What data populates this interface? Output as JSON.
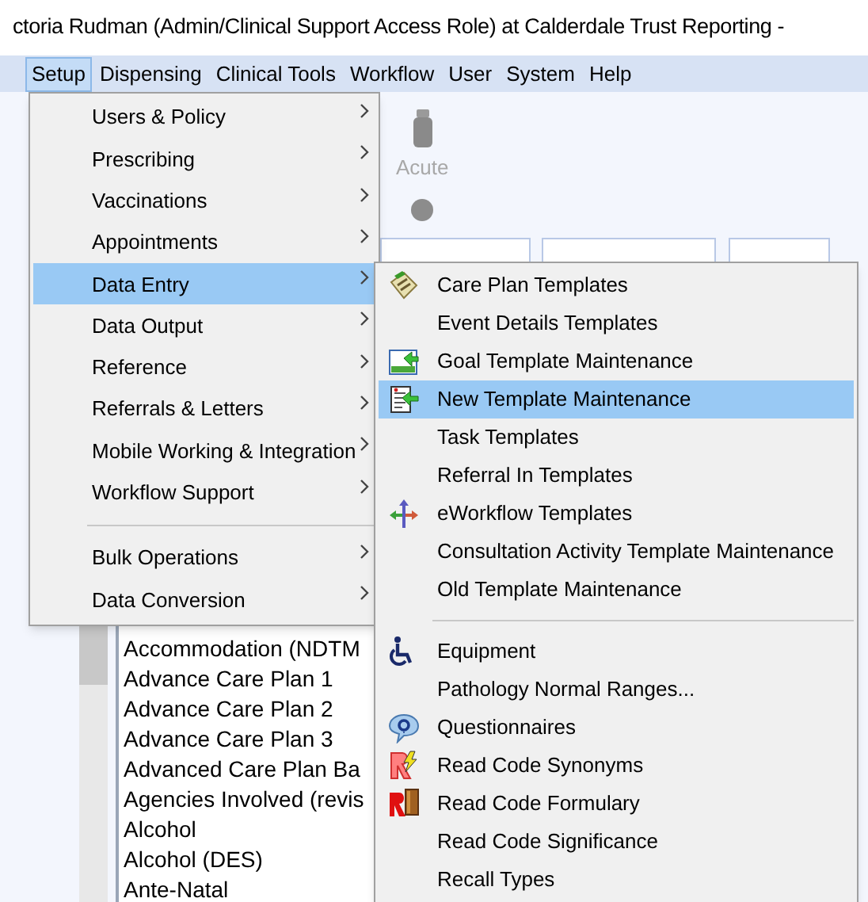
{
  "window": {
    "title": "ctoria Rudman (Admin/Clinical Support Access Role) at Calderdale Trust Reporting -"
  },
  "menu_bar": [
    {
      "label": "Setup",
      "selected": true
    },
    {
      "label": "Dispensing",
      "selected": false
    },
    {
      "label": "Clinical Tools",
      "selected": false
    },
    {
      "label": "Workflow",
      "selected": false
    },
    {
      "label": "User",
      "selected": false
    },
    {
      "label": "System",
      "selected": false
    },
    {
      "label": "Help",
      "selected": false
    }
  ],
  "toolbar": {
    "acute_label": "Acute"
  },
  "list_items": [
    "Accommodation (NDTM",
    "Advance Care Plan 1",
    "Advance Care Plan 2",
    "Advance Care Plan 3",
    "Advanced Care Plan Ba",
    "Agencies Involved (revis",
    "Alcohol",
    "Alcohol (DES)",
    "Ante-Natal"
  ],
  "setup_menu": [
    {
      "kind": "item",
      "label": "Users & Policy",
      "selected": false
    },
    {
      "kind": "item",
      "label": "Prescribing",
      "selected": false
    },
    {
      "kind": "item",
      "label": "Vaccinations",
      "selected": false
    },
    {
      "kind": "item",
      "label": "Appointments",
      "selected": false
    },
    {
      "kind": "item",
      "label": "Data Entry",
      "selected": true
    },
    {
      "kind": "item",
      "label": "Data Output",
      "selected": false
    },
    {
      "kind": "item",
      "label": "Reference",
      "selected": false
    },
    {
      "kind": "item",
      "label": "Referrals & Letters",
      "selected": false
    },
    {
      "kind": "item",
      "label": "Mobile Working & Integration",
      "selected": false
    },
    {
      "kind": "item",
      "label": "Workflow Support",
      "selected": false
    },
    {
      "kind": "separator"
    },
    {
      "kind": "item",
      "label": "Bulk Operations",
      "selected": false
    },
    {
      "kind": "item",
      "label": "Data Conversion",
      "selected": false
    }
  ],
  "data_entry_menu": [
    {
      "kind": "item",
      "label": "Care Plan Templates",
      "selected": false
    },
    {
      "kind": "item",
      "label": "Event Details Templates",
      "selected": false
    },
    {
      "kind": "item",
      "label": "Goal Template Maintenance",
      "selected": false
    },
    {
      "kind": "item",
      "label": "New Template Maintenance",
      "selected": true
    },
    {
      "kind": "item",
      "label": "Task Templates",
      "selected": false
    },
    {
      "kind": "item",
      "label": "Referral In Templates",
      "selected": false
    },
    {
      "kind": "item",
      "label": "eWorkflow Templates",
      "selected": false
    },
    {
      "kind": "item",
      "label": "Consultation Activity Template Maintenance",
      "selected": false
    },
    {
      "kind": "item",
      "label": "Old Template Maintenance",
      "selected": false
    },
    {
      "kind": "separator"
    },
    {
      "kind": "item",
      "label": "Equipment",
      "selected": false
    },
    {
      "kind": "item",
      "label": "Pathology Normal Ranges...",
      "selected": false
    },
    {
      "kind": "item",
      "label": "Questionnaires",
      "selected": false
    },
    {
      "kind": "item",
      "label": "Read Code Synonyms",
      "selected": false
    },
    {
      "kind": "item",
      "label": "Read Code Formulary",
      "selected": false
    },
    {
      "kind": "item",
      "label": "Read Code Significance",
      "selected": false
    },
    {
      "kind": "item",
      "label": "Recall Types",
      "selected": false
    }
  ]
}
